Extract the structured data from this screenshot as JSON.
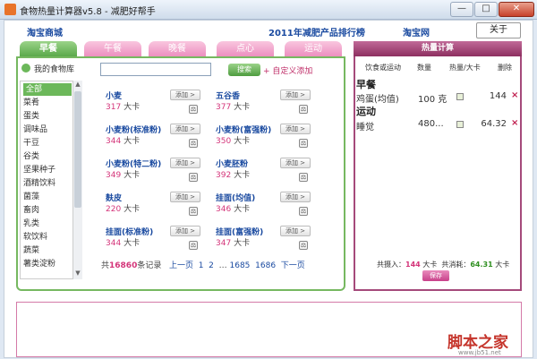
{
  "window": {
    "title": "食物热量计算器v5.8 - 减肥好帮手",
    "minimize": "—",
    "maximize": "□",
    "close": "✕"
  },
  "header": {
    "left_link": "淘宝商城",
    "center_title": "2011年减肥产品排行榜",
    "right_link": "淘宝网",
    "about": "关于"
  },
  "tabs": [
    {
      "label": "早餐",
      "active": true
    },
    {
      "label": "午餐",
      "active": false
    },
    {
      "label": "晚餐",
      "active": false
    },
    {
      "label": "点心",
      "active": false
    },
    {
      "label": "运动",
      "active": false
    }
  ],
  "library": {
    "title": "我的食物库",
    "categories": [
      "全部",
      "菜肴",
      "蛋类",
      "调味品",
      "干豆",
      "谷类",
      "坚果种子",
      "酒精饮料",
      "菌藻",
      "畜肉",
      "乳类",
      "软饮料",
      "蔬菜",
      "薯类淀粉"
    ],
    "selected_index": 0
  },
  "search": {
    "placeholder": "",
    "button": "搜索",
    "custom_add": "+ 自定义添加"
  },
  "foods": [
    {
      "name": "小麦",
      "kcal": "317",
      "unit": "大卡",
      "add": "添加 >"
    },
    {
      "name": "五谷香",
      "kcal": "377",
      "unit": "大卡",
      "add": "添加 >"
    },
    {
      "name": "小麦粉(标准粉)",
      "kcal": "344",
      "unit": "大卡",
      "add": "添加 >"
    },
    {
      "name": "小麦粉(富强粉)",
      "kcal": "350",
      "unit": "大卡",
      "add": "添加 >"
    },
    {
      "name": "小麦粉(特二粉)",
      "kcal": "349",
      "unit": "大卡",
      "add": "添加 >"
    },
    {
      "name": "小麦胚粉",
      "kcal": "392",
      "unit": "大卡",
      "add": "添加 >"
    },
    {
      "name": "麸皮",
      "kcal": "220",
      "unit": "大卡",
      "add": "添加 >"
    },
    {
      "name": "挂面(均值)",
      "kcal": "346",
      "unit": "大卡",
      "add": "添加 >"
    },
    {
      "name": "挂面(标准粉)",
      "kcal": "344",
      "unit": "大卡",
      "add": "添加 >"
    },
    {
      "name": "挂面(富强粉)",
      "kcal": "347",
      "unit": "大卡",
      "add": "添加 >"
    }
  ],
  "pager": {
    "prefix": "共",
    "total": "16860",
    "suffix": "条记录",
    "prev": "上一页",
    "p1": "1",
    "p2": "2",
    "ellipsis": "…",
    "p1685": "1685",
    "p1686": "1686",
    "next": "下一页"
  },
  "calc": {
    "header": "热量计算",
    "col_name": "饮食或运动",
    "col_qty": "数量",
    "col_kcal": "热量/大卡",
    "col_del": "删除",
    "breakfast_title": "早餐",
    "breakfast_name": "鸡蛋(均值)",
    "breakfast_qty": "100 克",
    "breakfast_kcal": "144",
    "exercise_title": "运动",
    "exercise_name": "睡觉",
    "exercise_qty": "480...",
    "exercise_kcal": "64.32",
    "del_symbol": "×",
    "intake_label": "共摄入：",
    "intake_value": "144",
    "intake_unit": "大卡",
    "burn_label": "共消耗：",
    "burn_value": "64.31",
    "burn_unit": "大卡",
    "save": "保存"
  },
  "watermark": {
    "text": "脚本之家",
    "url": "www.jb51.net"
  },
  "colors": {
    "green_accent": "#5aa94a",
    "pink_accent": "#ec8fbf",
    "calc_border": "#a54a7b",
    "kcal_number": "#d4357a"
  }
}
